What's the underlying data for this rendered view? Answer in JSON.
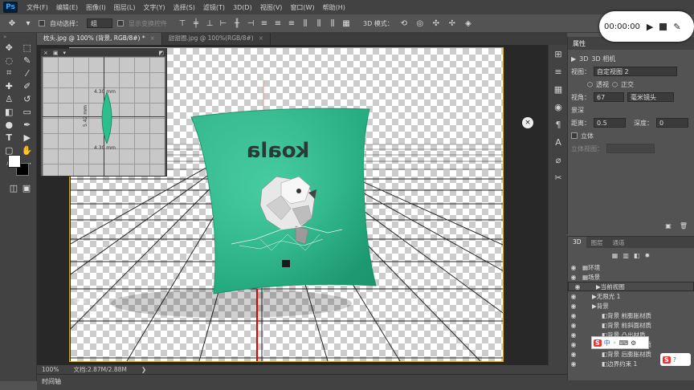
{
  "app": {
    "logo": "Ps"
  },
  "menu": [
    "文件(F)",
    "编辑(E)",
    "图像(I)",
    "图层(L)",
    "文字(Y)",
    "选择(S)",
    "滤镜(T)",
    "3D(D)",
    "视图(V)",
    "窗口(W)",
    "帮助(H)"
  ],
  "options": {
    "auto_select": "自动选择：",
    "auto_select_value": "组",
    "transform_controls": "显示变换控件",
    "mode_3d": "3D 模式："
  },
  "tabs": [
    {
      "label": "枕头.jpg @ 100% (背景, RGB/8#) *"
    },
    {
      "label": "甜甜圈.jpg @ 100%(RGB/8#)"
    }
  ],
  "canvas": {
    "pillow_text": "koala",
    "pillow_color": "#2bc191"
  },
  "mini_view": {
    "label_top": "4.30 mm",
    "label_bottom": "4.30 mm",
    "label_left": "5.42 mm"
  },
  "status": {
    "zoom": "100%",
    "doc_size": "文档:2.87M/2.88M"
  },
  "timeline": {
    "label": "时间轴"
  },
  "properties": {
    "tab": "属性",
    "header": "3D 相机",
    "view_label": "视图：",
    "view_value": "自定视图 2",
    "perspective": "透视",
    "orthographic": "正交",
    "fov_label": "视角：",
    "fov_value": "67",
    "lens_value": "毫米镜头",
    "dof_label": "景深",
    "distance_label": "距离：",
    "distance_value": "0.5",
    "depth_label": "深度：",
    "depth_value": "0",
    "stereo_label": "立体",
    "stereo_view_label": "立体视图："
  },
  "panel3d": {
    "tabs": [
      "3D",
      "图层",
      "通道"
    ],
    "items": [
      {
        "label": "环境",
        "indent": 0
      },
      {
        "label": "场景",
        "indent": 0
      },
      {
        "label": "当前视图",
        "indent": 1,
        "selected": true
      },
      {
        "label": "无限光 1",
        "indent": 1
      },
      {
        "label": "背景",
        "indent": 1
      },
      {
        "label": "背景 前膨胀材质",
        "indent": 2
      },
      {
        "label": "背景 前斜面材质",
        "indent": 2
      },
      {
        "label": "背景 凸出材质",
        "indent": 2
      },
      {
        "label": "背景 后斜面材质",
        "indent": 2
      },
      {
        "label": "背景 后膨胀材质",
        "indent": 2
      },
      {
        "label": "边界约束 1",
        "indent": 2
      }
    ]
  },
  "recorder": {
    "time": "00:00:00"
  },
  "ime": {
    "label": "中"
  }
}
